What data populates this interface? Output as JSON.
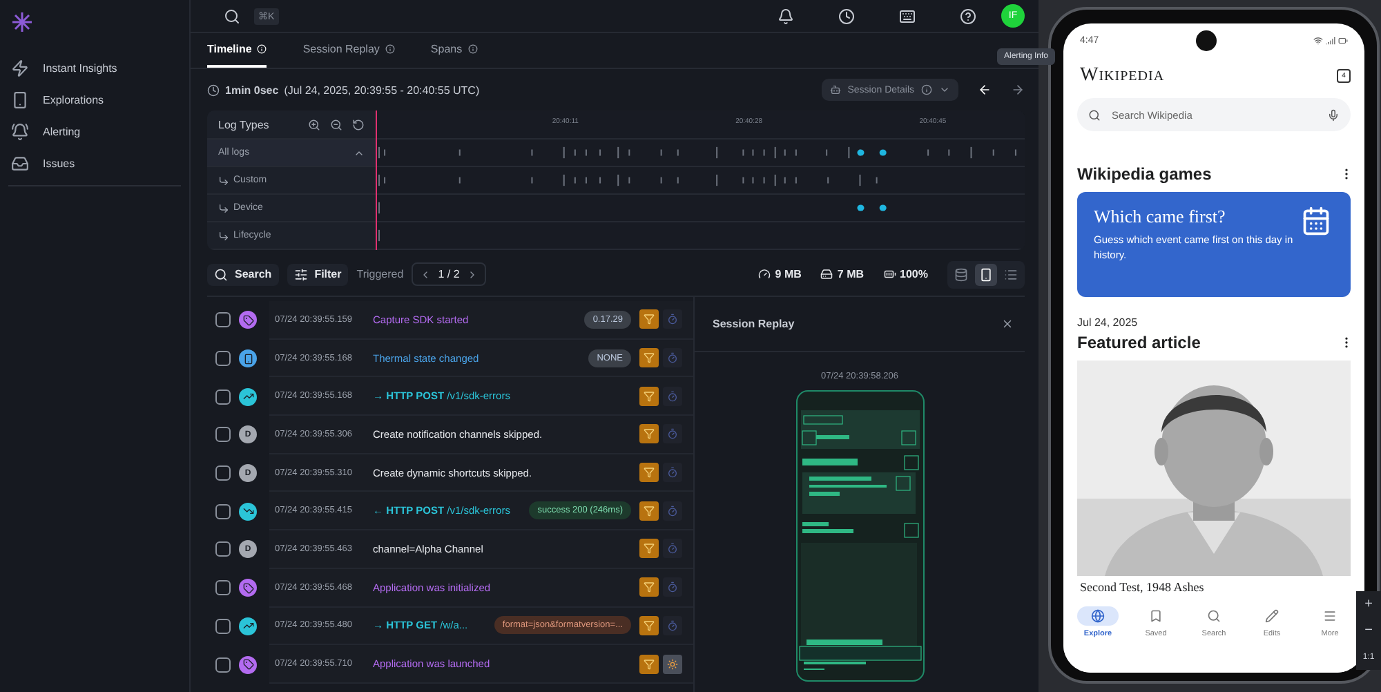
{
  "sidebar": {
    "items": [
      {
        "label": "Instant Insights",
        "kind": "insights"
      },
      {
        "label": "Explorations",
        "kind": "explorations"
      },
      {
        "label": "Alerting",
        "kind": "alerting"
      },
      {
        "label": "Issues",
        "kind": "issues"
      }
    ]
  },
  "topbar": {
    "shortcut": "⌘K",
    "avatar": "IF",
    "tooltip": "Alerting Info"
  },
  "tabs": [
    {
      "label": "Timeline",
      "selected": true
    },
    {
      "label": "Session Replay",
      "selected": false
    },
    {
      "label": "Spans",
      "selected": false
    }
  ],
  "duration": {
    "length": "1min 0sec",
    "range": "(Jul 24, 2025, 20:39:55 - 20:40:55 UTC)"
  },
  "session_details": "Session Details",
  "timeline": {
    "title": "Log Types",
    "ticks": [
      "20:40:11",
      "20:40:28",
      "20:40:45"
    ],
    "lanes": [
      {
        "label": "All logs",
        "kind": "all",
        "expanded": true
      },
      {
        "label": "Custom",
        "kind": "custom"
      },
      {
        "label": "Device",
        "kind": "device"
      },
      {
        "label": "Lifecycle",
        "kind": "lifecycle"
      }
    ]
  },
  "toolbar": {
    "search": "Search",
    "filter": "Filter",
    "triggered": "Triggered",
    "pager": "1 / 2",
    "stats": [
      {
        "kind": "memory",
        "value": "9 MB"
      },
      {
        "kind": "storage",
        "value": "7 MB"
      },
      {
        "kind": "battery",
        "value": "100%"
      }
    ],
    "views": [
      {
        "kind": "database",
        "selected": false
      },
      {
        "kind": "device",
        "selected": true
      },
      {
        "kind": "list",
        "selected": false
      }
    ]
  },
  "logs": [
    {
      "time": "07/24 20:39:55.159",
      "kind": "custom",
      "message": "Capture SDK started",
      "badge": {
        "text": "0.17.29",
        "color": "#3b4048"
      },
      "checked": false,
      "current": false
    },
    {
      "time": "07/24 20:39:55.168",
      "kind": "device",
      "message": "Thermal state changed",
      "badge": {
        "text": "NONE",
        "color": "#3b4048"
      },
      "checked": false,
      "current": false
    },
    {
      "time": "07/24 20:39:55.168",
      "kind": "network-out",
      "message": "→ **HTTP POST** /v1/sdk-errors",
      "checked": false,
      "current": false
    },
    {
      "time": "07/24 20:39:55.306",
      "kind": "debug",
      "marker": "D",
      "message": "Create notification channels skipped.",
      "checked": false,
      "current": false
    },
    {
      "time": "07/24 20:39:55.310",
      "kind": "debug",
      "marker": "D",
      "message": "Create dynamic shortcuts skipped.",
      "checked": false,
      "current": false
    },
    {
      "time": "07/24 20:39:55.415",
      "kind": "network-in",
      "message": "← **HTTP POST** /v1/sdk-errors",
      "badge": {
        "text": "success 200 (246ms)",
        "color": "#1d3a2c"
      },
      "checked": false,
      "current": false
    },
    {
      "time": "07/24 20:39:55.463",
      "kind": "debug",
      "marker": "D",
      "message": "channel=Alpha Channel",
      "checked": false,
      "current": false
    },
    {
      "time": "07/24 20:39:55.468",
      "kind": "custom",
      "message": "Application was initialized",
      "checked": false,
      "current": false
    },
    {
      "time": "07/24 20:39:55.480",
      "kind": "network-out",
      "message": "→ **HTTP GET** /w/a...",
      "badge": {
        "text": "format=json&formatversion=...",
        "color": "#4a2e24"
      },
      "checked": false,
      "current": false
    },
    {
      "time": "07/24 20:39:55.710",
      "kind": "custom",
      "message": "Application was launched",
      "checked": false,
      "current": true
    }
  ],
  "replay": {
    "title": "Session Replay",
    "timestamp": "07/24 20:39:58.206"
  },
  "phone": {
    "time": "4:47",
    "logo": "Wikipedia",
    "tab_count": "4",
    "search_placeholder": "Search Wikipedia",
    "games_title": "Wikipedia games",
    "card_title": "Which came first?",
    "card_text": "Guess which event came first on this day in history.",
    "date": "Jul 24, 2025",
    "featured_title": "Featured article",
    "article_title": "Second Test, 1948 Ashes",
    "nav": [
      {
        "label": "Explore",
        "kind": "explore",
        "selected": true
      },
      {
        "label": "Saved",
        "kind": "saved",
        "selected": false
      },
      {
        "label": "Search",
        "kind": "search",
        "selected": false
      },
      {
        "label": "Edits",
        "kind": "edits",
        "selected": false
      },
      {
        "label": "More",
        "kind": "more",
        "selected": false
      }
    ]
  },
  "zoom_controls": [
    "+",
    "−",
    "1:1"
  ]
}
